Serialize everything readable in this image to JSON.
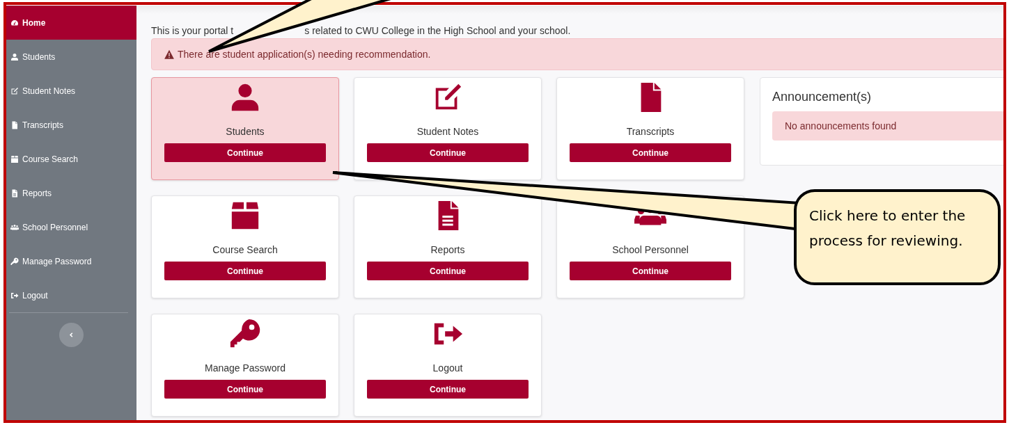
{
  "sidebar": {
    "items": [
      {
        "label": "Home",
        "selected": true
      },
      {
        "label": "Students",
        "selected": false
      },
      {
        "label": "Student Notes",
        "selected": false
      },
      {
        "label": "Transcripts",
        "selected": false
      },
      {
        "label": "Course Search",
        "selected": false
      },
      {
        "label": "Reports",
        "selected": false
      },
      {
        "label": "School Personnel",
        "selected": false
      },
      {
        "label": "Manage Password",
        "selected": false
      },
      {
        "label": "Logout",
        "selected": false
      }
    ]
  },
  "intro": {
    "visible_parts": [
      "This is your portal t",
      "s related to CWU College in the High School and your school."
    ]
  },
  "alert": {
    "text": "There are student application(s) needing recommendation."
  },
  "cards": [
    {
      "label": "Students",
      "button": "Continue",
      "selected": true
    },
    {
      "label": "Student Notes",
      "button": "Continue",
      "selected": false
    },
    {
      "label": "Transcripts",
      "button": "Continue",
      "selected": false
    },
    {
      "label": "Course Search",
      "button": "Continue",
      "selected": false
    },
    {
      "label": "Reports",
      "button": "Continue",
      "selected": false
    },
    {
      "label": "School Personnel",
      "button": "Continue",
      "selected": false
    },
    {
      "label": "Manage Password",
      "button": "Continue",
      "selected": false
    },
    {
      "label": "Logout",
      "button": "Continue",
      "selected": false
    }
  ],
  "announcements": {
    "title": "Announcement(s)",
    "message": "No announcements found"
  },
  "callout": {
    "text": "Click here to enter the process for reviewing."
  }
}
